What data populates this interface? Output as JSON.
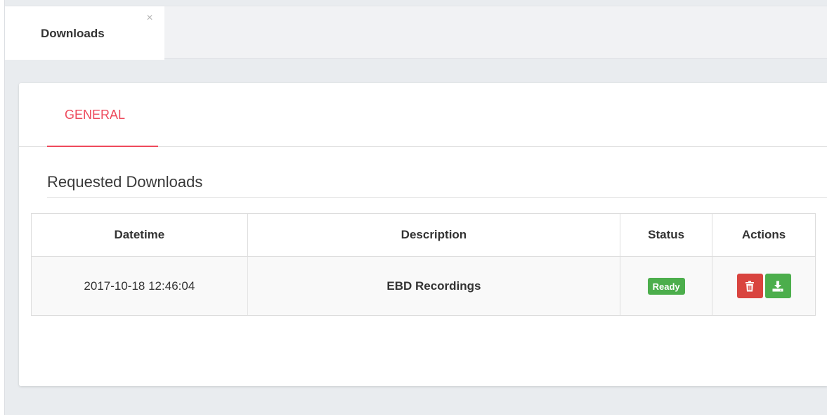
{
  "window": {
    "tab_title": "Downloads",
    "tab_close_glyph": "×"
  },
  "card": {
    "tabs": [
      {
        "label": "GENERAL",
        "active": true
      }
    ],
    "section_title": "Requested Downloads"
  },
  "table": {
    "columns": [
      "Datetime",
      "Description",
      "Status",
      "Actions"
    ],
    "rows": [
      {
        "datetime": "2017-10-18 12:46:04",
        "description": "EBD Recordings",
        "status": "Ready",
        "actions": [
          "trash-icon",
          "download-icon"
        ]
      }
    ]
  },
  "colors": {
    "accent": "#ee4a5c",
    "success": "#4cae4c",
    "danger": "#d9443f",
    "background": "#e9ecef"
  }
}
